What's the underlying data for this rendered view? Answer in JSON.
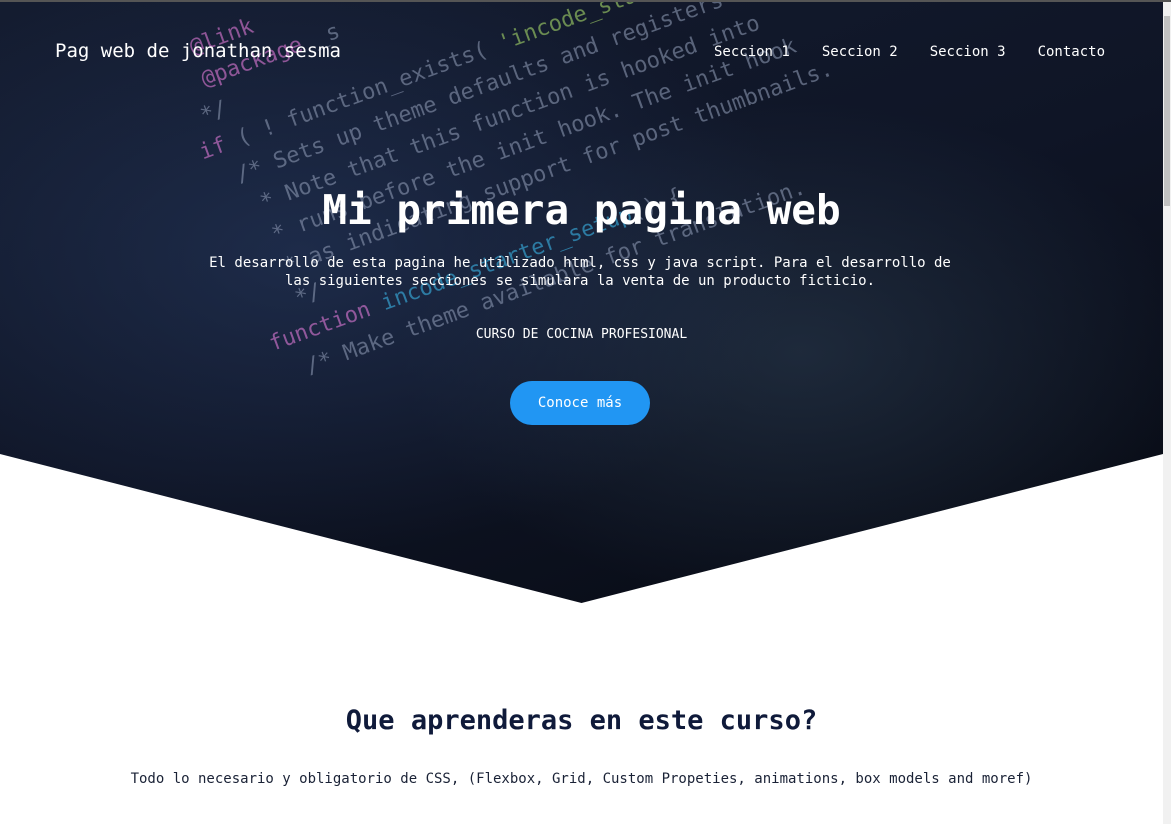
{
  "nav": {
    "brand": "Pag web de jonathan sesma",
    "links": [
      "Seccion 1",
      "Seccion 2",
      "Seccion 3",
      "Contacto"
    ]
  },
  "hero": {
    "title": "Mi primera pagina web",
    "description": "El desarrollo de esta pagina he utilizado html, css y java script. Para el desarrollo de las siguientes secciones se simulara la venta de un producto ficticio.",
    "course": "CURSO DE COCINA PROFESIONAL",
    "cta_label": "Conoce más"
  },
  "section": {
    "title": "Que aprenderas en este curso?",
    "subtitle": "Todo lo necesario y obligatorio de CSS, (Flexbox, Grid, Custom Propeties, animations, box models and moref)"
  },
  "colors": {
    "accent": "#2196f3",
    "heading": "#0f1a3a"
  }
}
